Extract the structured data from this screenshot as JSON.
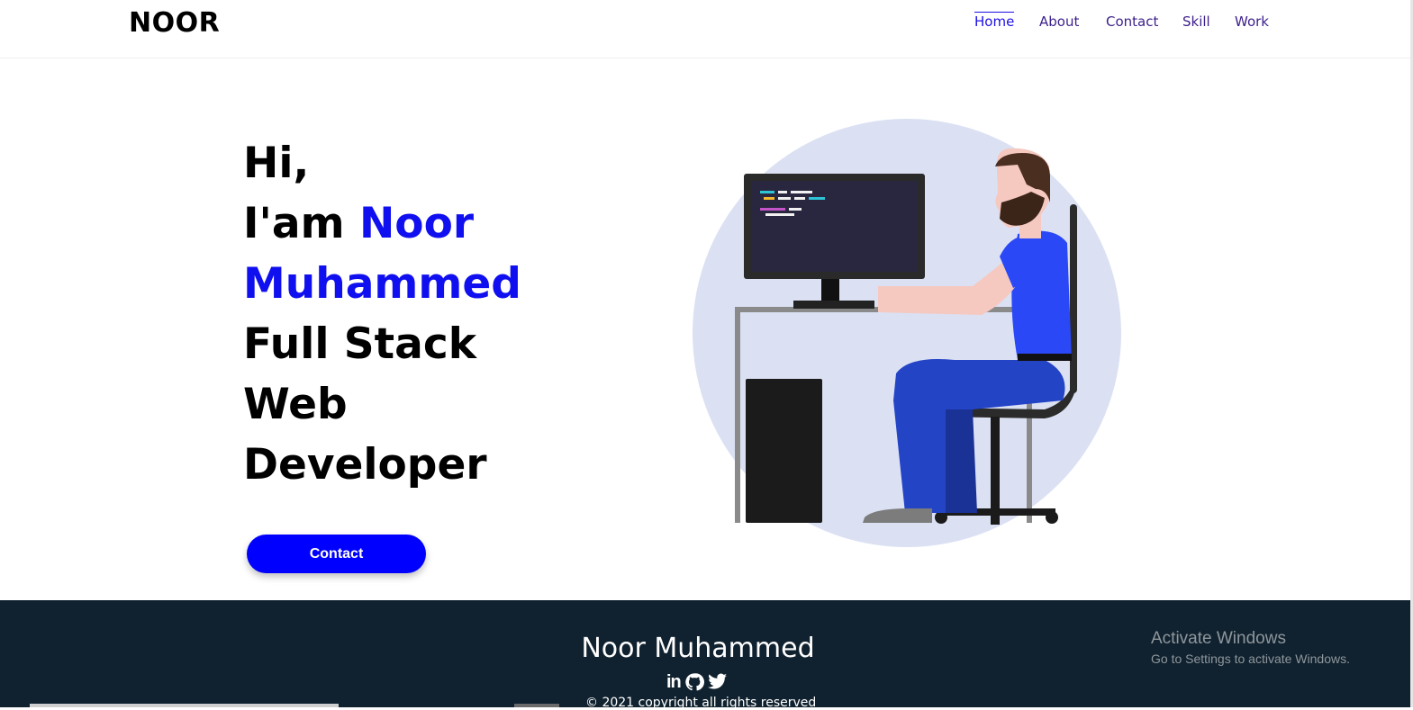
{
  "header": {
    "logo": "NOOR",
    "nav": [
      {
        "label": "Home",
        "active": true
      },
      {
        "label": "About",
        "active": false
      },
      {
        "label": "Contact",
        "active": false
      },
      {
        "label": "Skill",
        "active": false
      },
      {
        "label": "Work",
        "active": false
      }
    ]
  },
  "hero": {
    "greeting": "Hi,",
    "intro_prefix": "I'am",
    "name_first": "Noor",
    "name_last": "Muhammed",
    "role_line1": "Full Stack",
    "role_line2": "Web",
    "role_line3": "Developer",
    "contact_button": "Contact",
    "illustration_icon": "developer-at-desk-illustration"
  },
  "footer": {
    "name": "Noor Muhammed",
    "social": [
      {
        "label": "in",
        "icon": "linkedin-icon"
      },
      {
        "icon": "github-icon"
      },
      {
        "icon": "twitter-icon"
      }
    ],
    "copyright": "© 2021 copyright all rights reserved"
  },
  "overlay": {
    "activate_title": "Activate Windows",
    "activate_sub": "Go to Settings to activate Windows."
  },
  "colors": {
    "accent": "#0000ff",
    "name_accent": "#0f0ff0",
    "footer_bg": "#10222f",
    "nav_link": "#3c1f8c",
    "nav_active": "#1d10e6",
    "circle_bg": "#dbe1f3"
  }
}
